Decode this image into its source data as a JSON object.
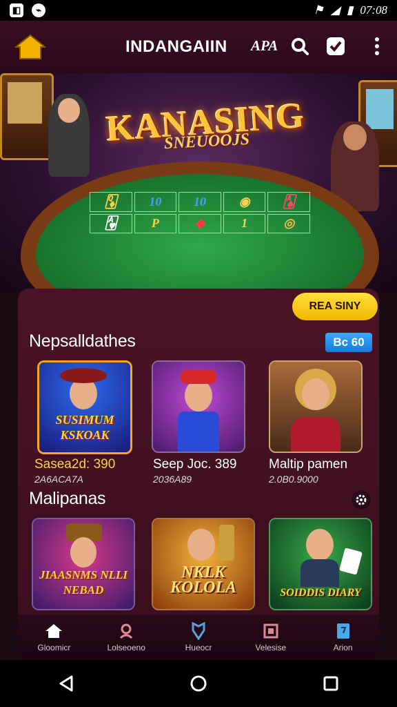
{
  "statusbar": {
    "time": "07:08",
    "left_icons": [
      "notification-icon",
      "messenger-icon"
    ],
    "right_icons": [
      "signal-icon",
      "wifi-icon",
      "battery-icon"
    ]
  },
  "topbar": {
    "title": "INDANGAIIN",
    "subtitle": "APA"
  },
  "hero": {
    "title": "KANASING",
    "subtitle": "SNEUOOJS",
    "cells": [
      "🃍",
      "10",
      "10",
      "◉",
      "🂡",
      "🂱",
      "P",
      "◆",
      "1",
      "◎"
    ]
  },
  "panel": {
    "promo_button": "REA SINY",
    "section1": {
      "title": "Nepsalldathes",
      "badge": "Bc 60"
    },
    "section2": {
      "title": "Malipanas"
    },
    "cards_row1": [
      {
        "art_text": "SUSIMUM KSKOAK",
        "name": "Sasea2d: 390",
        "sub": "2A6ACA7A"
      },
      {
        "art_text": "",
        "name": "Seep Joc. 389",
        "sub": "2036A89"
      },
      {
        "art_text": "",
        "name": "Maltip pamen",
        "sub": "2.0B0.9000"
      }
    ],
    "cards_row2": [
      {
        "art_text": "JIAASNMS NLLI NEBAD"
      },
      {
        "art_text": "NKLK KOLOLA"
      },
      {
        "art_text": "SOIDDIS DIARY"
      }
    ]
  },
  "navbar": {
    "items": [
      {
        "label": "Gloomicr",
        "icon": "home-icon"
      },
      {
        "label": "Lolseoeno",
        "icon": "profile-icon"
      },
      {
        "label": "Hueocr",
        "icon": "gem-icon"
      },
      {
        "label": "Velesise",
        "icon": "wallet-icon"
      },
      {
        "label": "Arion",
        "icon": "bookmark-icon"
      }
    ]
  },
  "colors": {
    "accent": "#f5c400",
    "badge": "#2b90f0",
    "panel": "#4a1426"
  }
}
